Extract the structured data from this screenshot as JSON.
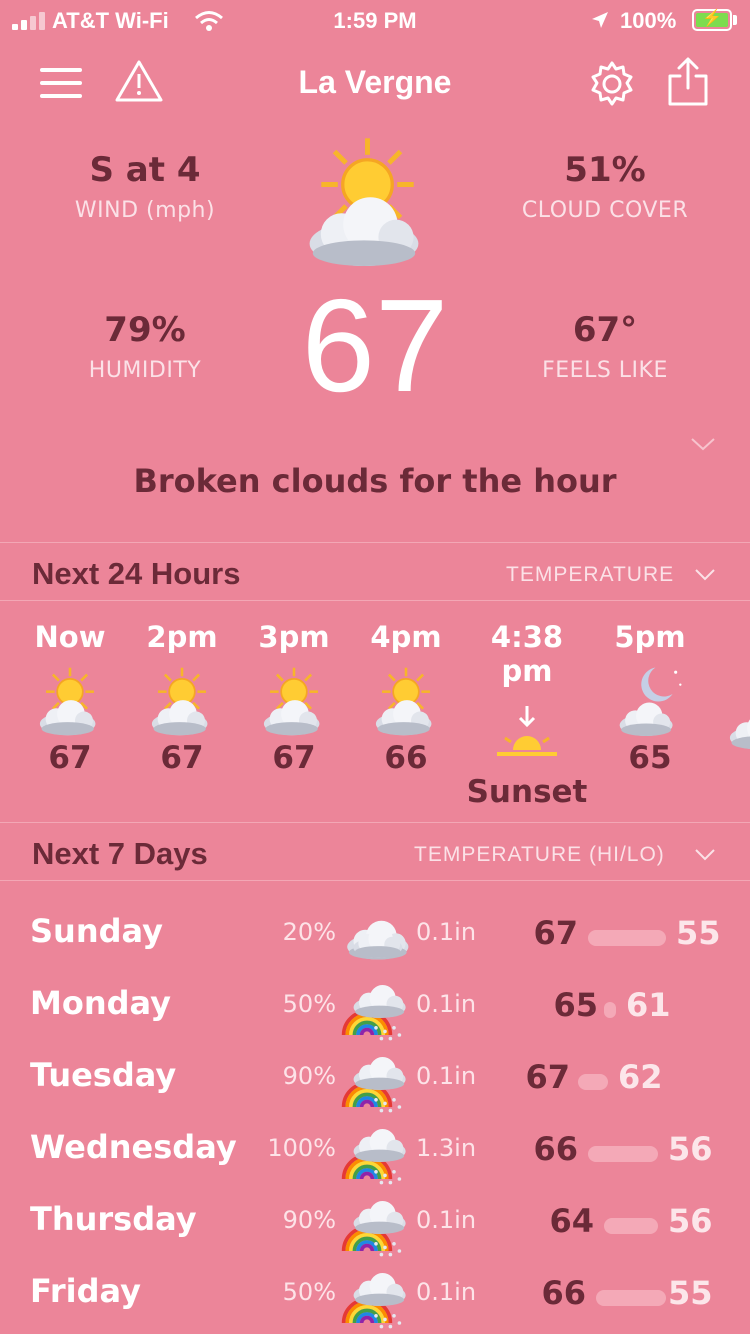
{
  "status": {
    "carrier": "AT&T Wi-Fi",
    "time": "1:59 PM",
    "battery": "100%"
  },
  "header": {
    "title": "La Vergne",
    "menu_icon": "hamburger-icon",
    "alert_icon": "warning-icon",
    "settings_icon": "gear-icon",
    "share_icon": "share-icon"
  },
  "current": {
    "wind_value": "S at 4",
    "wind_label": "WIND (mph)",
    "cloud_value": "51%",
    "cloud_label": "CLOUD COVER",
    "humidity_value": "79%",
    "humidity_label": "HUMIDITY",
    "feels_value": "67°",
    "feels_label": "FEELS LIKE",
    "temperature": "67",
    "icon": "partly-cloudy-icon",
    "summary": "Broken clouds for the hour"
  },
  "hourly": {
    "title": "Next 24 Hours",
    "selector": "TEMPERATURE",
    "items": [
      {
        "label": "Now",
        "value": "67",
        "icon": "partly-cloudy-icon"
      },
      {
        "label": "2pm",
        "value": "67",
        "icon": "partly-cloudy-icon"
      },
      {
        "label": "3pm",
        "value": "67",
        "icon": "partly-cloudy-icon"
      },
      {
        "label": "4pm",
        "value": "66",
        "icon": "partly-cloudy-icon"
      },
      {
        "label": "4:38 pm",
        "value": "Sunset",
        "icon": "sunset-icon"
      },
      {
        "label": "5pm",
        "value": "65",
        "icon": "night-cloudy-icon"
      }
    ]
  },
  "daily": {
    "title": "Next 7 Days",
    "selector": "TEMPERATURE (HI/LO)",
    "days": [
      {
        "name": "Sunday",
        "precip": "20%",
        "amount": "0.1in",
        "hi": "67",
        "lo": "55",
        "icon": "cloudy-icon"
      },
      {
        "name": "Monday",
        "precip": "50%",
        "amount": "0.1in",
        "hi": "65",
        "lo": "61",
        "icon": "rain-rainbow-icon"
      },
      {
        "name": "Tuesday",
        "precip": "90%",
        "amount": "0.1in",
        "hi": "67",
        "lo": "62",
        "icon": "rain-rainbow-icon"
      },
      {
        "name": "Wednesday",
        "precip": "100%",
        "amount": "1.3in",
        "hi": "66",
        "lo": "56",
        "icon": "rain-rainbow-icon"
      },
      {
        "name": "Thursday",
        "precip": "90%",
        "amount": "0.1in",
        "hi": "64",
        "lo": "56",
        "icon": "rain-rainbow-icon"
      },
      {
        "name": "Friday",
        "precip": "50%",
        "amount": "0.1in",
        "hi": "66",
        "lo": "55",
        "icon": "rain-rainbow-icon"
      }
    ]
  }
}
